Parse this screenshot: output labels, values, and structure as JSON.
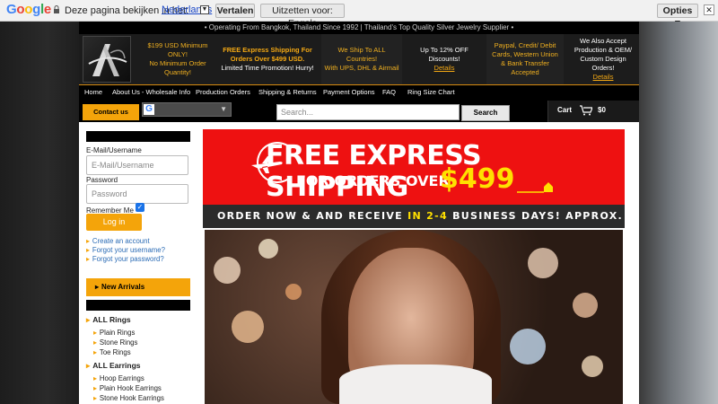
{
  "translate_bar": {
    "brand": "Google",
    "question": "Deze pagina bekijken in het:",
    "language": "Nederlands",
    "translate_button": "Vertalen",
    "disable_button": "Uitzetten voor: Engels",
    "options_button": "Opties ▼",
    "close": "✕"
  },
  "site": {
    "top_strip": "• Operating From Bangkok, Thailand Since 1992 | Thailand's Top Quality Silver Jewelry Supplier •",
    "header_cells": [
      {
        "l1": "$199 USD Minimum ONLY!",
        "l2": "No Minimum Order Quantity!"
      },
      {
        "l1": "FREE Express Shipping For Orders Over $499 USD.",
        "l2": "Limited Time Promotion! Hurry!"
      },
      {
        "l1": "We Ship To ALL Countries!",
        "l2": "With UPS, DHL & Airmail"
      },
      {
        "l1": "Up To 12% OFF Discounts!",
        "link": "Details"
      },
      {
        "l1": "Paypal, Credit/ Debit Cards, Western Union & Bank Transfer Accepted"
      },
      {
        "l1": "We Also Accept Production & OEM/ Custom Design Orders!",
        "link": "Details"
      }
    ],
    "nav": [
      "Home",
      "About Us - Wholesale Info",
      "Production Orders",
      "Shipping & Returns",
      "Payment Options",
      "FAQ",
      "Ring Size Chart"
    ],
    "contact_button": "Contact us",
    "search_placeholder": "Search...",
    "search_button": "Search",
    "cart_label": "Cart",
    "cart_value": "$0"
  },
  "login": {
    "email_label": "E-Mail/Username",
    "email_placeholder": "E-Mail/Username",
    "password_label": "Password",
    "password_placeholder": "Password",
    "remember_label": "Remember Me",
    "login_button": "Log in",
    "links": [
      "Create an account",
      "Forgot your username?",
      "Forgot your password?"
    ]
  },
  "sidebar": {
    "new_arrivals": "New Arrivals",
    "categories": [
      {
        "name": "ALL Rings",
        "items": [
          "Plain Rings",
          "Stone Rings",
          "Toe Rings"
        ]
      },
      {
        "name": "ALL Earrings",
        "items": [
          "Hoop Earrings",
          "Plain Hook Earrings",
          "Stone Hook Earrings"
        ]
      }
    ]
  },
  "banner": {
    "line1": "FREE EXPRESS SHIPPING",
    "line2": "FOR ORDERS OVER",
    "amount": "$499",
    "order_prefix": "ORDER NOW & AND RECEIVE",
    "order_days": "IN 2-4",
    "order_suffix": "BUSINESS DAYS! APPROX."
  },
  "colors": {
    "accent": "#f4a40a",
    "banner_red": "#e11111",
    "highlight_yellow": "#ffe000"
  }
}
